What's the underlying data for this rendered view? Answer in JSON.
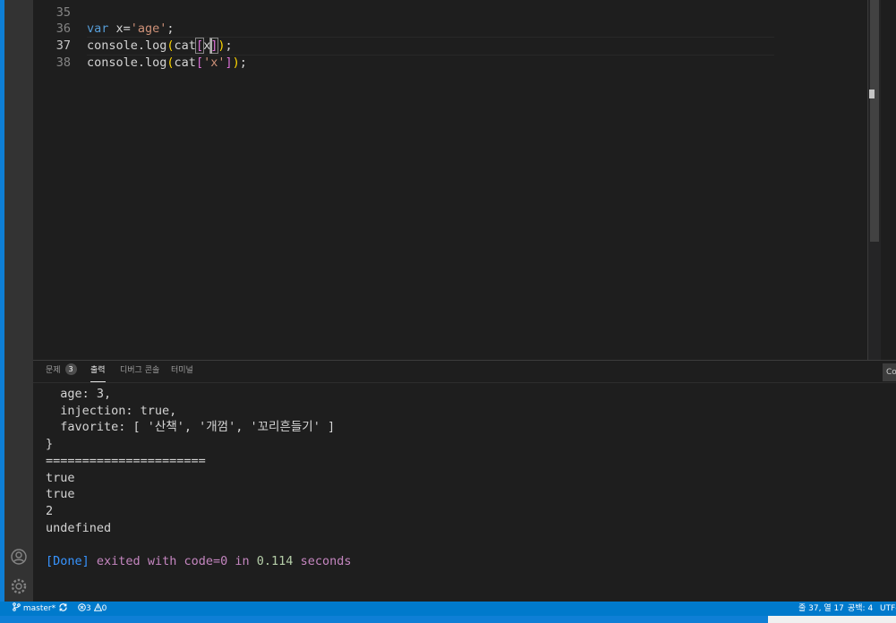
{
  "editor": {
    "lines": [
      {
        "num": "35",
        "tokens": []
      },
      {
        "num": "36",
        "tokens": [
          {
            "t": "var",
            "c": "kw"
          },
          {
            "t": " x=",
            "c": ""
          },
          {
            "t": "'age'",
            "c": "str"
          },
          {
            "t": ";",
            "c": ""
          }
        ]
      },
      {
        "num": "37",
        "tokens": [
          {
            "t": "console.log",
            "c": ""
          },
          {
            "t": "(",
            "c": "br2"
          },
          {
            "t": "cat",
            "c": ""
          },
          {
            "t": "[",
            "c": "br"
          },
          {
            "t": "x",
            "c": ""
          },
          {
            "t": "]",
            "c": "br"
          },
          {
            "t": ")",
            "c": "br2"
          },
          {
            "t": ";",
            "c": ""
          }
        ]
      },
      {
        "num": "38",
        "tokens": [
          {
            "t": "console.log",
            "c": ""
          },
          {
            "t": "(",
            "c": "br2"
          },
          {
            "t": "cat",
            "c": ""
          },
          {
            "t": "[",
            "c": "br"
          },
          {
            "t": "'x'",
            "c": "str"
          },
          {
            "t": "]",
            "c": "br"
          },
          {
            "t": ")",
            "c": "br2"
          },
          {
            "t": ";",
            "c": ""
          }
        ]
      }
    ]
  },
  "panel": {
    "tabs": [
      {
        "label": "문제",
        "badge": "3"
      },
      {
        "label": "출력"
      },
      {
        "label": "디버그 콘솔"
      },
      {
        "label": "터미널"
      }
    ],
    "dropdown_label": "Co",
    "output": [
      "  age: 3,",
      "  injection: true,",
      "  favorite: [ '산책', '개껌', '꼬리흔들기' ]",
      "}",
      "======================",
      "true",
      "true",
      "2",
      "undefined",
      ""
    ],
    "done": {
      "bracket": "[Done]",
      "exited": "exited with",
      "code": "code=0",
      "in": "in",
      "secs": "0.114",
      "seconds": "seconds"
    }
  },
  "statusbar": {
    "branch": "master*",
    "errors": "3",
    "warnings": "0",
    "position": "줄 37, 열 17",
    "spaces": "공백: 4",
    "encoding": "UTF-"
  },
  "colors": {
    "statusbar": "#007acc",
    "accent": "#0e7fd6"
  }
}
